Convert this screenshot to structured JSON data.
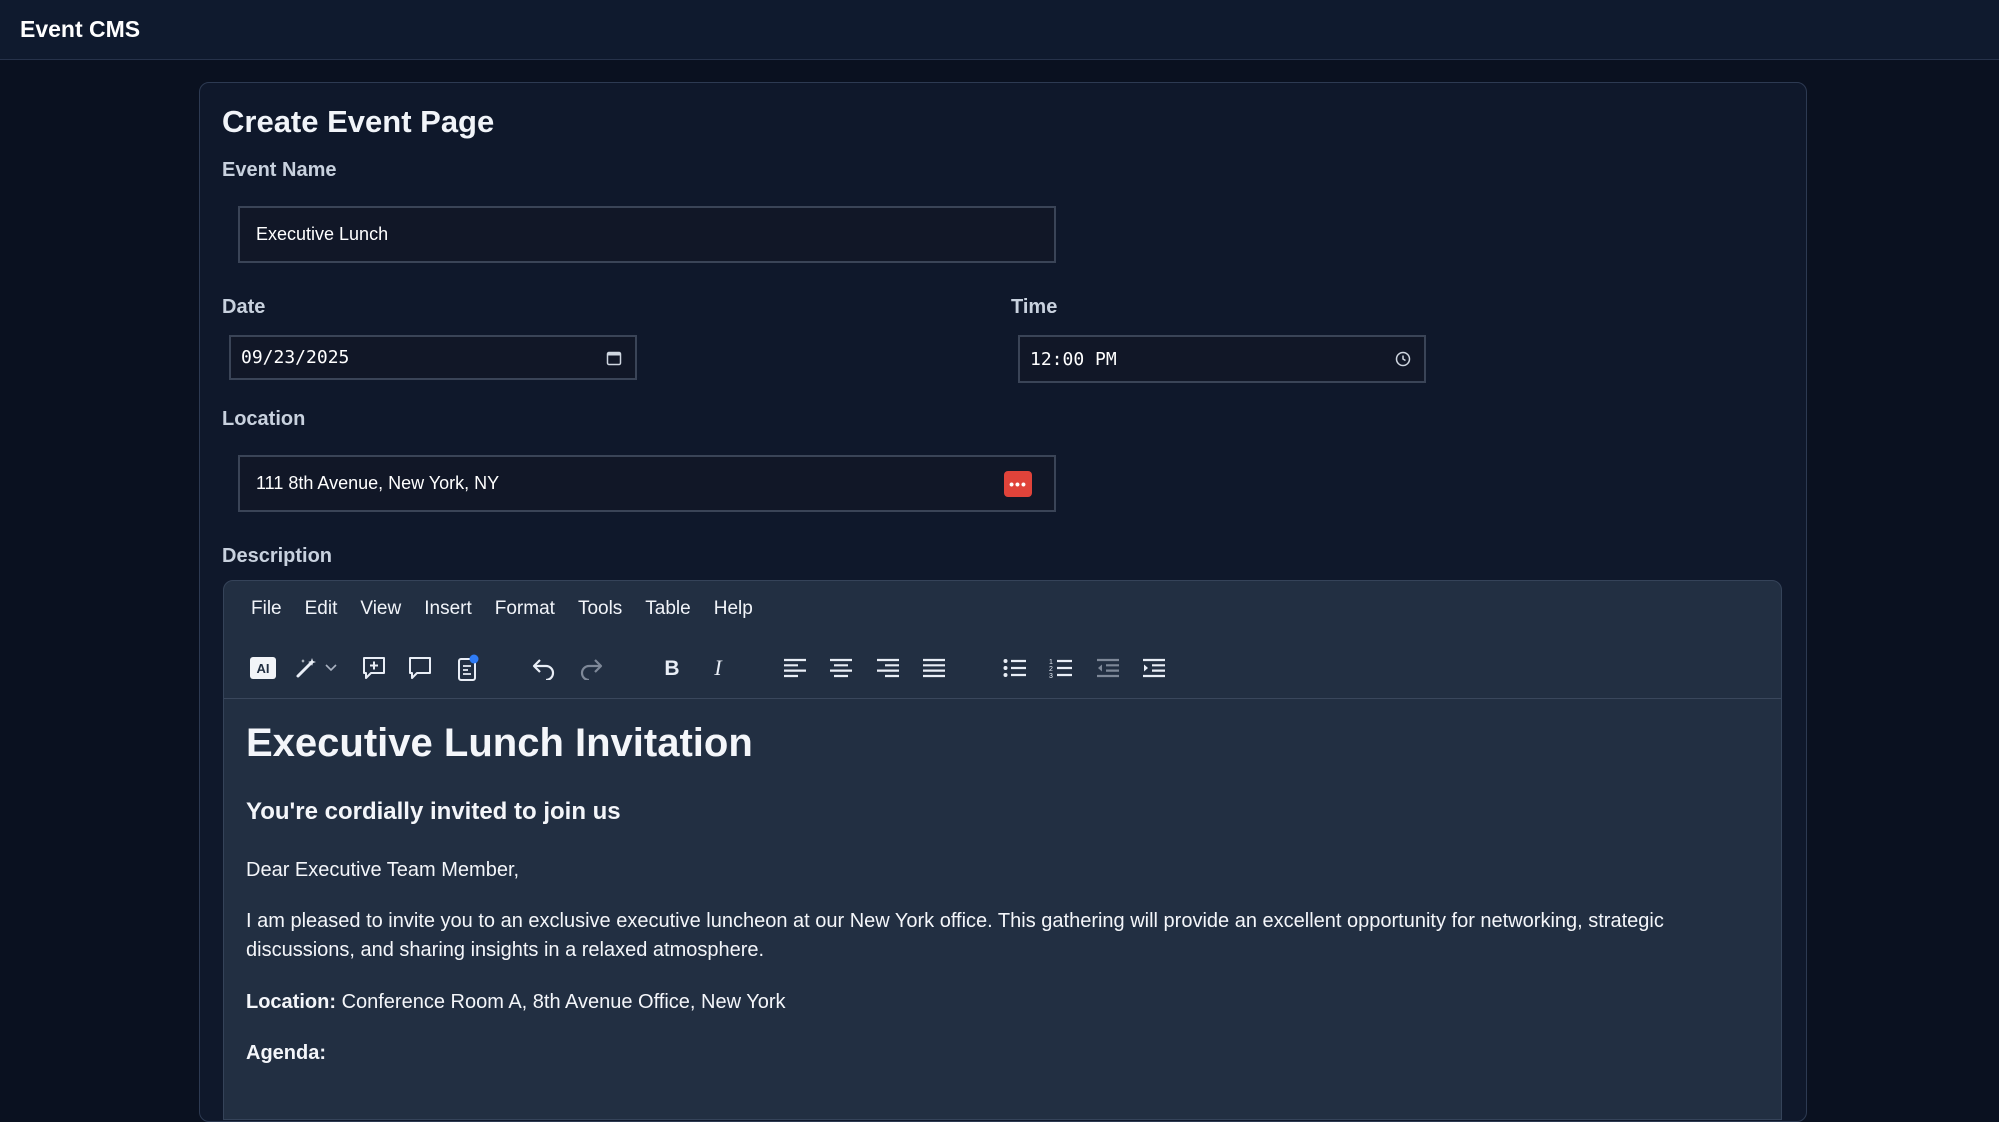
{
  "app": {
    "title": "Event CMS"
  },
  "form": {
    "page_title": "Create Event Page",
    "event_name": {
      "label": "Event Name",
      "value": "Executive Lunch"
    },
    "date": {
      "label": "Date",
      "value": "09/23/2025"
    },
    "time": {
      "label": "Time",
      "value": "12:00 PM"
    },
    "location": {
      "label": "Location",
      "value": "111 8th Avenue, New York, NY"
    },
    "description": {
      "label": "Description"
    }
  },
  "editor": {
    "menus": [
      "File",
      "Edit",
      "View",
      "Insert",
      "Format",
      "Tools",
      "Table",
      "Help"
    ],
    "toolbar_icons": [
      "ai-icon",
      "magic-wand-icon",
      "add-comment-icon",
      "comment-icon",
      "clipboard-icon",
      "undo-icon",
      "redo-icon",
      "bold-icon",
      "italic-icon",
      "align-left-icon",
      "align-center-icon",
      "align-right-icon",
      "align-justify-icon",
      "bullet-list-icon",
      "numbered-list-icon",
      "outdent-icon",
      "indent-icon"
    ],
    "content": {
      "heading": "Executive Lunch Invitation",
      "subheading": "You're cordially invited to join us",
      "greeting": "Dear Executive Team Member,",
      "body": "I am pleased to invite you to an exclusive executive luncheon at our New York office. This gathering will provide an excellent opportunity for networking, strategic discussions, and sharing insights in a relaxed atmosphere.",
      "location_label": "Location:",
      "location_value": "Conference Room A, 8th Avenue Office, New York",
      "agenda_label": "Agenda:"
    }
  },
  "colors": {
    "background": "#0a1120",
    "card": "#0f182b",
    "editor": "#222f42",
    "password_manager_icon": "#e0433a"
  }
}
